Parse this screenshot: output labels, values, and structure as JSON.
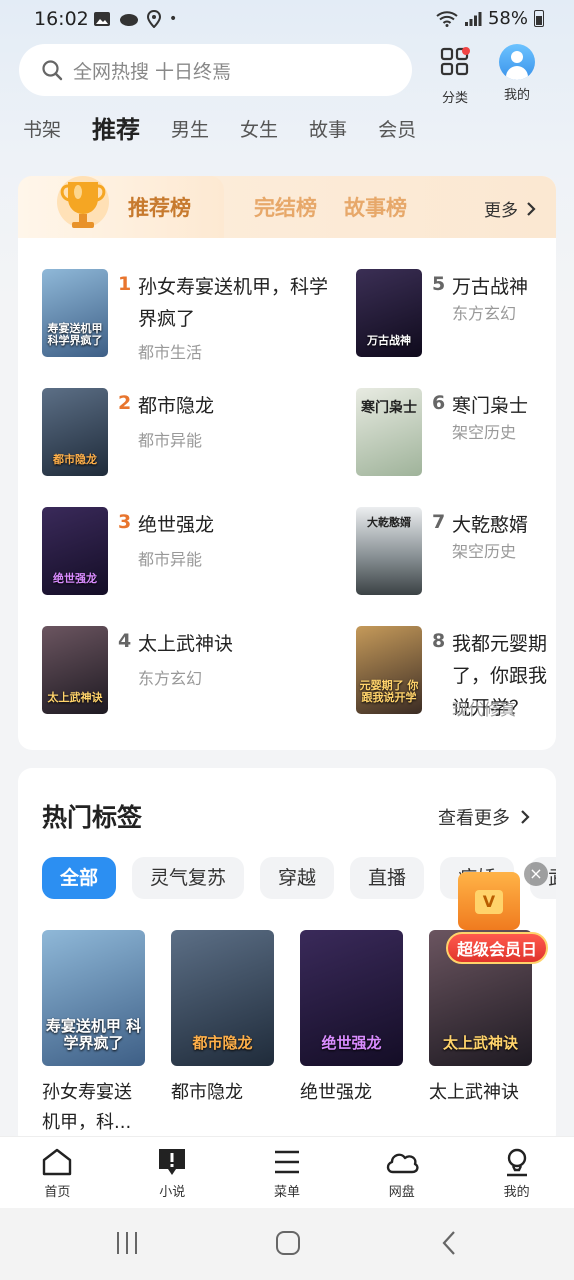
{
  "status_bar": {
    "time": "16:02",
    "battery": "58%"
  },
  "search": {
    "placeholder": "全网热搜 十日终焉"
  },
  "top_actions": {
    "category_label": "分类",
    "me_label": "我的"
  },
  "tabs": [
    {
      "label": "书架",
      "active": false
    },
    {
      "label": "推荐",
      "active": true
    },
    {
      "label": "男生",
      "active": false
    },
    {
      "label": "女生",
      "active": false
    },
    {
      "label": "故事",
      "active": false
    },
    {
      "label": "会员",
      "active": false
    }
  ],
  "rankings": {
    "tabs": [
      "推荐榜",
      "完结榜",
      "故事榜"
    ],
    "active_tab": "推荐榜",
    "more_label": "更多",
    "items": [
      {
        "rank": "1",
        "title": "孙女寿宴送机甲，科学界疯了",
        "genre": "都市生活",
        "cover_text": "寿宴送机甲 科学界疯了",
        "cover_colors": [
          "#8fb8d8",
          "#3e5f86"
        ]
      },
      {
        "rank": "2",
        "title": "都市隐龙",
        "genre": "都市异能",
        "cover_text": "都市隐龙",
        "cover_colors": [
          "#5c6f86",
          "#1f2b3a"
        ]
      },
      {
        "rank": "3",
        "title": "绝世强龙",
        "genre": "都市异能",
        "cover_text": "绝世强龙",
        "cover_colors": [
          "#3a2a5a",
          "#140d26"
        ]
      },
      {
        "rank": "4",
        "title": "太上武神诀",
        "genre": "东方玄幻",
        "cover_text": "太上武神诀",
        "cover_colors": [
          "#6b5560",
          "#1e1a22"
        ]
      },
      {
        "rank": "5",
        "title": "万古战神",
        "genre": "东方玄幻",
        "cover_text": "万古战神",
        "cover_colors": [
          "#3b2f55",
          "#0f0a1c"
        ]
      },
      {
        "rank": "6",
        "title": "寒门枭士",
        "genre": "架空历史",
        "cover_text": "寒门枭士",
        "cover_colors": [
          "#e8ebe2",
          "#9fb39a"
        ]
      },
      {
        "rank": "7",
        "title": "大乾憨婿",
        "genre": "架空历史",
        "cover_text": "大乾憨婿",
        "cover_colors": [
          "#cfd3d6",
          "#4d5558"
        ]
      },
      {
        "rank": "8",
        "title": "我都元婴期了，你跟我说开学？",
        "genre": "现代修真",
        "cover_text": "元婴期了 你跟我说开学",
        "cover_colors": [
          "#c59a5a",
          "#3b2c24"
        ]
      }
    ]
  },
  "hot_tags": {
    "title": "热门标签",
    "more_label": "查看更多",
    "chips": [
      "全部",
      "灵气复苏",
      "穿越",
      "直播",
      "病娇",
      "武"
    ],
    "active_chip": "全部",
    "books": [
      {
        "title": "孙女寿宴送机甲，科...",
        "cover_text": "寿宴送机甲 科学界疯了",
        "cover_colors": [
          "#8fb8d8",
          "#3e5f86"
        ]
      },
      {
        "title": "都市隐龙",
        "cover_text": "都市隐龙",
        "cover_colors": [
          "#5c6f86",
          "#1f2b3a"
        ]
      },
      {
        "title": "绝世强龙",
        "cover_text": "绝世强龙",
        "cover_colors": [
          "#3a2a5a",
          "#140d26"
        ]
      },
      {
        "title": "太上武神诀",
        "cover_text": "太上武神诀",
        "cover_colors": [
          "#6b5560",
          "#1e1a22"
        ]
      }
    ]
  },
  "promo": {
    "label": "超级会员日",
    "badge": "V"
  },
  "bottom_nav": [
    {
      "label": "首页",
      "icon": "home-icon"
    },
    {
      "label": "小说",
      "icon": "novel-icon"
    },
    {
      "label": "菜单",
      "icon": "menu-icon"
    },
    {
      "label": "网盘",
      "icon": "cloud-icon"
    },
    {
      "label": "我的",
      "icon": "profile-icon"
    }
  ],
  "colors": {
    "accent_blue": "#2c8ff2",
    "rank_hot": "#e8752e",
    "rank_tab_gold": "#c77a2e"
  }
}
